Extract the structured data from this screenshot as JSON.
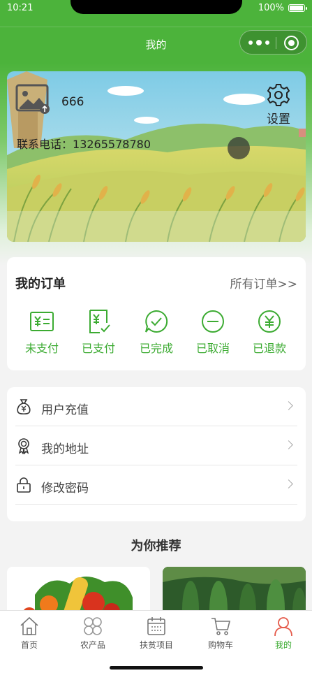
{
  "status_bar": {
    "time": "10:21",
    "battery": "100%"
  },
  "nav": {
    "title": "我的"
  },
  "profile": {
    "username": "666",
    "phone_label": "联系电话：",
    "phone": "13265578780",
    "settings_label": "设置"
  },
  "orders": {
    "title": "我的订单",
    "all_label": "所有订单>>",
    "statuses": [
      {
        "label": "未支付",
        "icon": "unpaid-icon"
      },
      {
        "label": "已支付",
        "icon": "paid-icon"
      },
      {
        "label": "已完成",
        "icon": "completed-icon"
      },
      {
        "label": "已取消",
        "icon": "cancelled-icon"
      },
      {
        "label": "已退款",
        "icon": "refunded-icon"
      }
    ]
  },
  "menu": {
    "items": [
      {
        "label": "用户充值",
        "icon": "money-bag-icon"
      },
      {
        "label": "我的地址",
        "icon": "badge-icon"
      },
      {
        "label": "修改密码",
        "icon": "lock-icon"
      }
    ]
  },
  "recommend": {
    "title": "为你推荐"
  },
  "tabbar": {
    "items": [
      {
        "label": "首页",
        "icon": "home-icon"
      },
      {
        "label": "农产品",
        "icon": "grid-icon"
      },
      {
        "label": "扶贫项目",
        "icon": "calendar-icon"
      },
      {
        "label": "购物车",
        "icon": "cart-icon"
      },
      {
        "label": "我的",
        "icon": "user-icon",
        "active": true
      }
    ]
  },
  "colors": {
    "brand_green": "#3cab32",
    "nav_green": "#4cb33b",
    "user_accent": "#e55a4a"
  }
}
